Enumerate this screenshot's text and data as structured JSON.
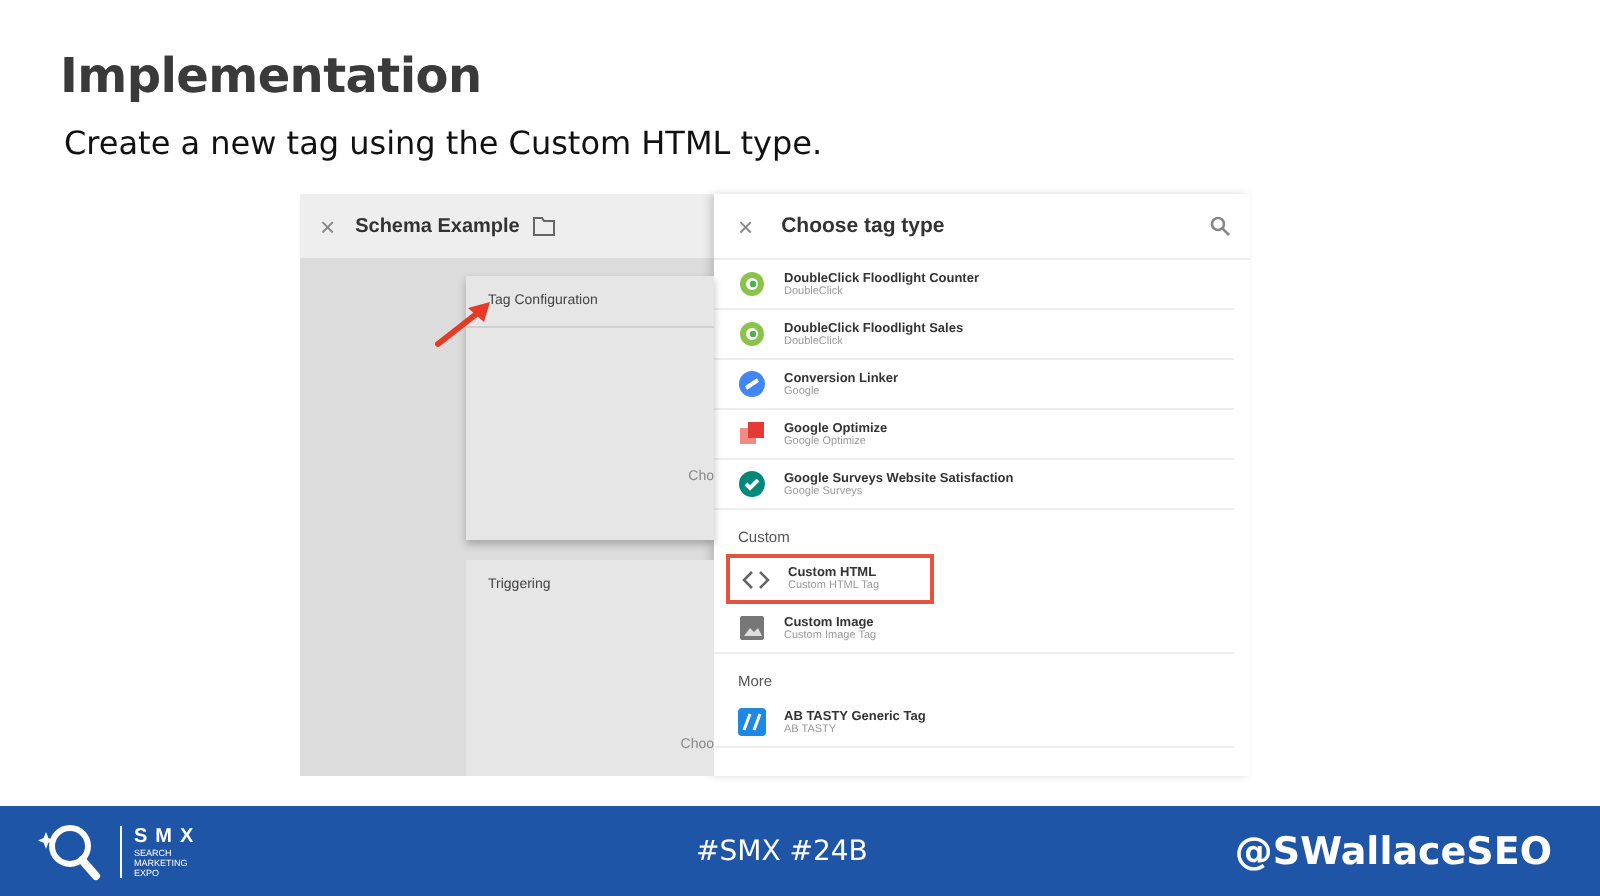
{
  "title": "Implementation",
  "subtitle": "Create a new tag using the Custom HTML type.",
  "screenshot": {
    "editor": {
      "close": "×",
      "name": "Schema Example",
      "cards": [
        {
          "label": "Tag Configuration",
          "hint": "Cho",
          "pointed": true
        },
        {
          "label": "Triggering",
          "hint": "Choo",
          "pointed": false
        }
      ]
    },
    "panel": {
      "close": "×",
      "title": "Choose tag type",
      "sections": [
        {
          "items": [
            {
              "name": "DoubleClick Floodlight Counter",
              "vendor": "DoubleClick",
              "kind": "ring",
              "highlighted": false
            },
            {
              "name": "DoubleClick Floodlight Sales",
              "vendor": "DoubleClick",
              "kind": "ring",
              "highlighted": false
            },
            {
              "name": "Conversion Linker",
              "vendor": "Google",
              "kind": "link",
              "highlighted": false
            },
            {
              "name": "Google Optimize",
              "vendor": "Google Optimize",
              "kind": "squares",
              "highlighted": false
            },
            {
              "name": "Google Surveys Website Satisfaction",
              "vendor": "Google Surveys",
              "kind": "check",
              "highlighted": false
            }
          ]
        },
        {
          "heading": "Custom",
          "items": [
            {
              "name": "Custom HTML",
              "vendor": "Custom HTML Tag",
              "kind": "code",
              "highlighted": true
            },
            {
              "name": "Custom Image",
              "vendor": "Custom Image Tag",
              "kind": "image",
              "highlighted": false
            }
          ]
        },
        {
          "heading": "More",
          "items": [
            {
              "name": "AB TASTY Generic Tag",
              "vendor": "AB TASTY",
              "kind": "abtasty",
              "highlighted": false
            }
          ]
        }
      ]
    }
  },
  "footer": {
    "brand": "SMX",
    "brand_sub": "SEARCH MARKETING EXPO",
    "hashtags": "#SMX #24B",
    "handle": "@SWallaceSEO"
  }
}
